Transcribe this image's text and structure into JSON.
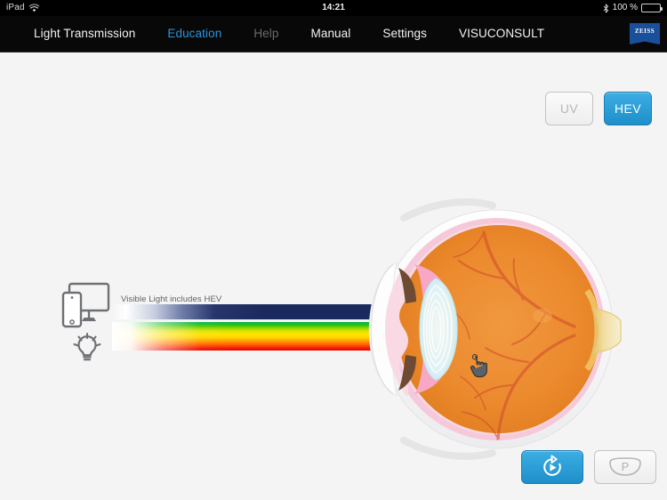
{
  "statusbar": {
    "device": "iPad",
    "wifi_icon": "wifi-icon",
    "time": "14:21",
    "bluetooth_icon": "bluetooth-icon",
    "battery_percent": "100 %",
    "battery_icon": "battery-full-icon"
  },
  "navbar": {
    "items": [
      {
        "label": "Light Transmission",
        "state": "normal"
      },
      {
        "label": "Education",
        "state": "active"
      },
      {
        "label": "Help",
        "state": "disabled"
      },
      {
        "label": "Manual",
        "state": "normal"
      },
      {
        "label": "Settings",
        "state": "normal"
      },
      {
        "label": "VISUCONSULT",
        "state": "normal"
      }
    ],
    "logo_text": "ZEISS",
    "active_color": "#2f93d8",
    "disabled_color": "#6c6c6c",
    "background": "#080808"
  },
  "toggle": {
    "uv_label": "UV",
    "hev_label": "HEV",
    "selected": "HEV",
    "active_color": "#1e8fc9",
    "inactive_text_color": "#b6b6b6"
  },
  "diagram": {
    "beam_label": "Visible Light includes HEV",
    "source_icons": [
      "monitor-icon",
      "smartphone-icon",
      "lightbulb-icon"
    ],
    "eye_icon": "eye-cross-section-illustration",
    "cursor_icon": "hand-pointer-cursor",
    "hev_band_color": "#1a2a5e",
    "spectrum_colors": [
      "#00b050",
      "#ffe400",
      "#ffa200",
      "#e00000"
    ]
  },
  "actions": {
    "replay_label": "replay",
    "replay_icon": "replay-arrow-icon",
    "lens_label": "P",
    "lens_icon": "lens-p-icon"
  },
  "theme": {
    "stage_background": "#f4f4f4",
    "accent": "#1e8fc9"
  }
}
